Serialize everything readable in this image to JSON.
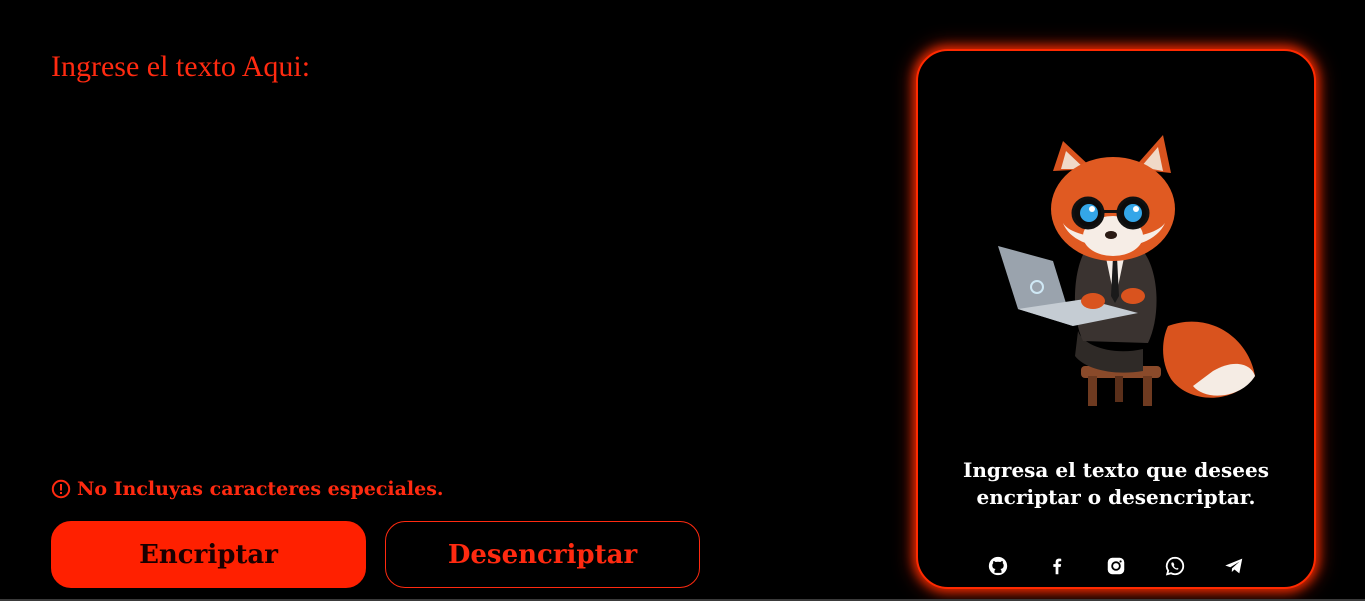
{
  "main": {
    "title": "Ingrese el texto Aqui:",
    "textarea_value": "",
    "warning_text": "No Incluyas caracteres especiales.",
    "encrypt_label": "Encriptar",
    "decrypt_label": "Desencriptar"
  },
  "card": {
    "image_alt": "fox-with-laptop",
    "message": "Ingresa el texto que desees encriptar o desencriptar.",
    "socials": [
      {
        "icon": "github-icon"
      },
      {
        "icon": "facebook-icon"
      },
      {
        "icon": "instagram-icon"
      },
      {
        "icon": "whatsapp-icon"
      },
      {
        "icon": "telegram-icon"
      }
    ]
  },
  "colors": {
    "accent": "#ff2a10",
    "background": "#000000",
    "card_text": "#ffffff"
  }
}
